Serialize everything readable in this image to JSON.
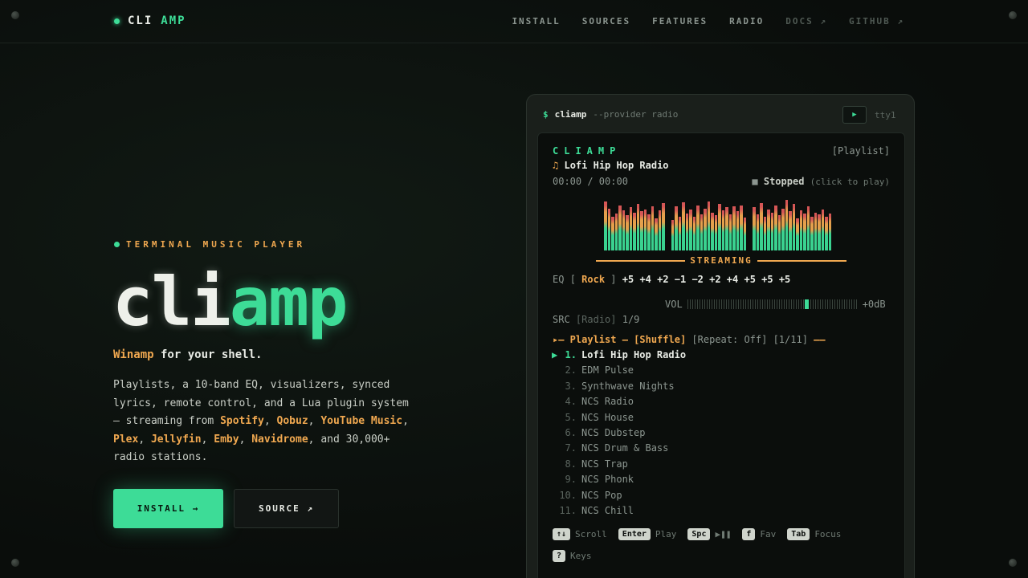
{
  "nav": {
    "logo_a": "CLI",
    "logo_b": "AMP",
    "links": [
      {
        "label": "INSTALL",
        "dim": false
      },
      {
        "label": "SOURCES",
        "dim": false
      },
      {
        "label": "FEATURES",
        "dim": false
      },
      {
        "label": "RADIO",
        "dim": false
      },
      {
        "label": "DOCS ↗",
        "dim": true
      },
      {
        "label": "GITHUB ↗",
        "dim": true
      }
    ]
  },
  "hero": {
    "kicker": "TERMINAL MUSIC PLAYER",
    "title_a": "cli",
    "title_b": "amp",
    "tagline_a": "Winamp",
    "tagline_b": " for your shell.",
    "desc_1": "Playlists, a 10-band EQ, visualizers, synced lyrics, remote control, and a Lua plugin system — streaming from ",
    "desc_spotify": "Spotify",
    "desc_c1": ", ",
    "desc_qobuz": "Qobuz",
    "desc_c2": ", ",
    "desc_yt": "YouTube Music",
    "desc_c3": ", ",
    "desc_plex": "Plex",
    "desc_c4": ", ",
    "desc_jelly": "Jellyfin",
    "desc_c5": ", ",
    "desc_emby": "Emby",
    "desc_c6": ", ",
    "desc_navi": "Navidrome",
    "desc_2": ", and 30,000+ radio stations.",
    "install_label": "INSTALL →",
    "source_label": "SOURCE ↗"
  },
  "terminal": {
    "prompt": "$",
    "command": "cliamp",
    "flag": "--provider radio",
    "play_icon": "▶",
    "tty": "tty1",
    "brand": "CLIAMP",
    "view_tag": "[Playlist]",
    "note_icon": "♫",
    "now_playing": "Lofi Hip Hop Radio",
    "time": "00:00 / 00:00",
    "stop_icon": "■",
    "status": "Stopped",
    "status_hint": "(click to play)",
    "streaming_label": "STREAMING",
    "eq_label": "EQ",
    "eq_open": "[",
    "eq_preset": "Rock",
    "eq_close": "]",
    "eq_values": "+5 +4 +2 −1 −2 +2 +4 +5 +5 +5",
    "vol_label": "VOL",
    "vol_db": "+0dB",
    "src_label": "SRC",
    "src_value": "[Radio]",
    "src_count": "1/9",
    "playlist_prefix": "▸— Playlist —",
    "shuffle": "[Shuffle]",
    "repeat": "[Repeat: Off]",
    "track_count": "[1/11]",
    "playlist_suffix": "——",
    "items": [
      {
        "num": "1.",
        "name": "Lofi Hip Hop Radio",
        "active": true
      },
      {
        "num": "2.",
        "name": "EDM Pulse",
        "active": false
      },
      {
        "num": "3.",
        "name": "Synthwave Nights",
        "active": false
      },
      {
        "num": "4.",
        "name": "NCS Radio",
        "active": false
      },
      {
        "num": "5.",
        "name": "NCS House",
        "active": false
      },
      {
        "num": "6.",
        "name": "NCS Dubstep",
        "active": false
      },
      {
        "num": "7.",
        "name": "NCS Drum & Bass",
        "active": false
      },
      {
        "num": "8.",
        "name": "NCS Trap",
        "active": false
      },
      {
        "num": "9.",
        "name": "NCS Phonk",
        "active": false
      },
      {
        "num": "10.",
        "name": "NCS Pop",
        "active": false
      },
      {
        "num": "11.",
        "name": "NCS Chill",
        "active": false
      }
    ],
    "keys": [
      {
        "key": "↑↓",
        "label": "Scroll"
      },
      {
        "key": "Enter",
        "label": "Play"
      },
      {
        "key": "Spc",
        "label": "▶❚❚"
      },
      {
        "key": "f",
        "label": "Fav"
      },
      {
        "key": "Tab",
        "label": "Focus"
      },
      {
        "key": "?",
        "label": "Keys"
      }
    ]
  },
  "colors": {
    "accent": "#3ddc97",
    "amber": "#f0a850",
    "red": "#e05a5a"
  },
  "visualizer": {
    "groups": [
      [
        0.95,
        0.82,
        0.66,
        0.72,
        0.88,
        0.78,
        0.69,
        0.85,
        0.74,
        0.9,
        0.76,
        0.8,
        0.7,
        0.86,
        0.62,
        0.78,
        0.92
      ],
      [
        0.6,
        0.86,
        0.66,
        0.94,
        0.72,
        0.8,
        0.66,
        0.88,
        0.7,
        0.82,
        0.96,
        0.74,
        0.68,
        0.9,
        0.78,
        0.84,
        0.7,
        0.86,
        0.76,
        0.88,
        0.64
      ],
      [
        0.84,
        0.7,
        0.92,
        0.66,
        0.8,
        0.74,
        0.88,
        0.68,
        0.82,
        0.98,
        0.76,
        0.9,
        0.62,
        0.78,
        0.72,
        0.86,
        0.66,
        0.74,
        0.7,
        0.8,
        0.66,
        0.72
      ]
    ]
  }
}
